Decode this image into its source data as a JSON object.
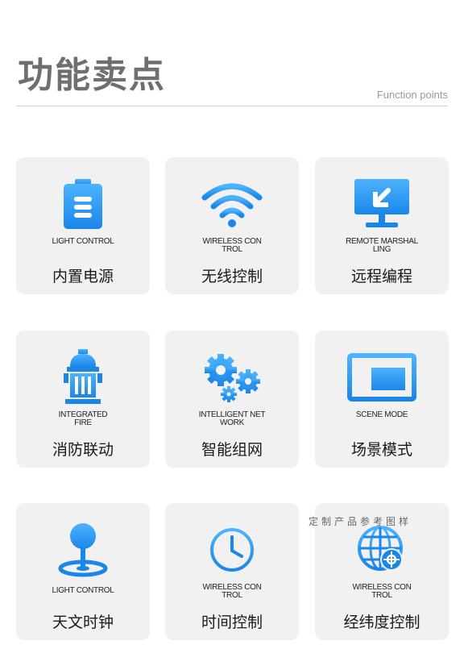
{
  "header": {
    "title": "功能卖点",
    "subtitle": "Function points"
  },
  "colors": {
    "accent": "#2f9ef5",
    "card_bg": "#f1f1f1"
  },
  "features": [
    {
      "en": "LIGHT CONTROL",
      "cn": "内置电源",
      "icon": "battery-icon"
    },
    {
      "en": "WIRELESS CON TROL",
      "cn": "无线控制",
      "icon": "wifi-icon"
    },
    {
      "en": "REMOTE MARSHAL LING",
      "cn": "远程编程",
      "icon": "monitor-icon"
    },
    {
      "en": "INTEGRATED FIRE",
      "cn": "消防联动",
      "icon": "fire-hydrant-icon"
    },
    {
      "en": "INTELLIGENT NET WORK",
      "cn": "智能组网",
      "icon": "gears-icon"
    },
    {
      "en": "SCENE MODE",
      "cn": "场景模式",
      "icon": "screen-icon"
    },
    {
      "en": "LIGHT CONTROL",
      "cn": "天文时钟",
      "icon": "joystick-icon"
    },
    {
      "en": "WIRELESS CON TROL",
      "cn": "时间控制",
      "icon": "clock-icon"
    },
    {
      "en": "WIRELESS CON TROL",
      "cn": "经纬度控制",
      "icon": "globe-icon"
    }
  ],
  "watermark": "定制产品参考图样"
}
